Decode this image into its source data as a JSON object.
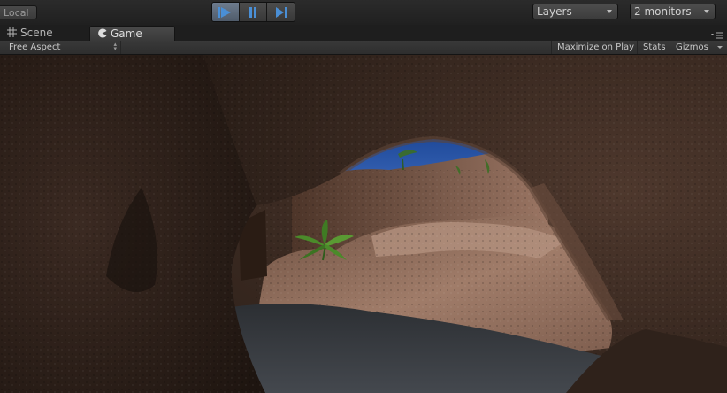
{
  "toolbar": {
    "pivot_label": "Local",
    "play_icon": "play-icon",
    "pause_icon": "pause-icon",
    "step_icon": "step-icon",
    "layers_label": "Layers",
    "layout_label": "2 monitors"
  },
  "tabs": [
    {
      "label": "Scene",
      "icon": "scene-grid-icon",
      "active": false
    },
    {
      "label": "Game",
      "icon": "game-pacman-icon",
      "active": true
    }
  ],
  "game_view": {
    "aspect_label": "Free Aspect",
    "maximize_label": "Maximize on Play",
    "stats_label": "Stats",
    "gizmos_label": "Gizmos"
  },
  "colors": {
    "accent_play": "#4a8fd6",
    "cave_rock": "#3a2921",
    "sky": "#2a56a6",
    "water": "#3a3d42",
    "plant": "#4b8a2a"
  }
}
